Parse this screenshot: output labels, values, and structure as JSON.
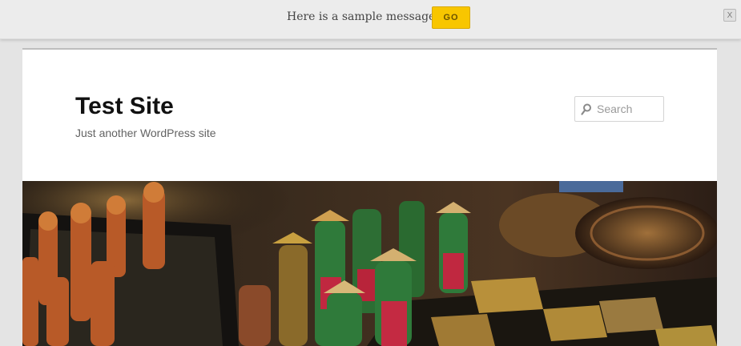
{
  "notice": {
    "message": "Here is a sample message.",
    "go_label": "GO",
    "close_label": "X"
  },
  "site": {
    "title": "Test Site",
    "description": "Just another WordPress site"
  },
  "search": {
    "placeholder": "Search",
    "value": ""
  },
  "header_image": {
    "icon": "chess-photo"
  },
  "colors": {
    "go_button": "#f8c600",
    "notice_bg": "#ececec",
    "page_bg": "#ffffff",
    "body_bg": "#e4e4e4"
  }
}
